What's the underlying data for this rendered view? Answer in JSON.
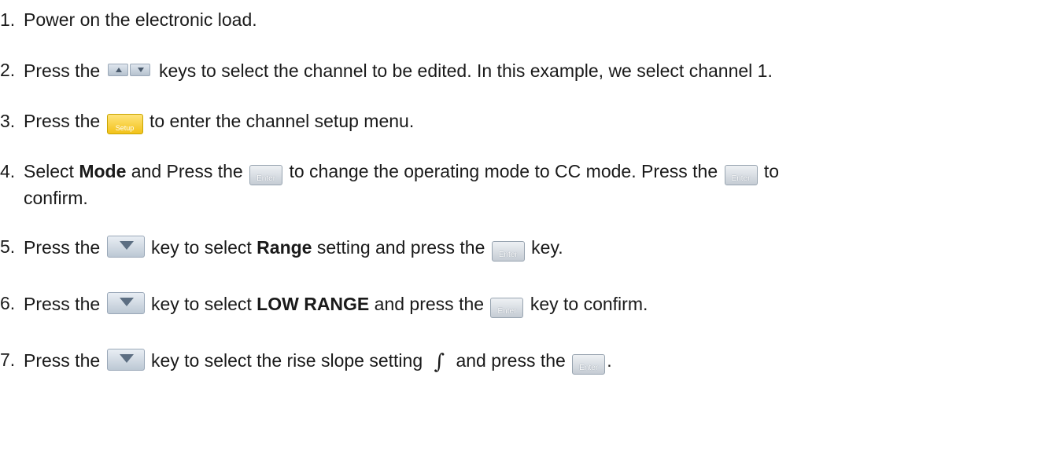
{
  "steps": [
    {
      "num": "1.",
      "text": "Power on the electronic load."
    },
    {
      "num": "2.",
      "pre": "Press the",
      "post": "keys to select the channel to be edited. In this example, we select channel 1."
    },
    {
      "num": "3.",
      "pre": "Press the",
      "post": "to enter the channel setup menu."
    },
    {
      "num": "4.",
      "pre": "Select",
      "bold": "Mode",
      "mid1": "and Press the",
      "mid2": "to change the operating mode to CC mode. Press the",
      "tail": "to",
      "cont": "confirm."
    },
    {
      "num": "5.",
      "pre": "Press the",
      "mid1": "key to select",
      "bold": "Range",
      "mid2": "setting and press the",
      "tail": "key."
    },
    {
      "num": "6.",
      "pre": "Press the",
      "mid1": "key to select",
      "bold": "LOW RANGE",
      "mid2": "and press the",
      "tail": "key to confirm."
    },
    {
      "num": "7.",
      "pre": "Press the",
      "mid1": "key to select the rise slope setting",
      "slope": "∫",
      "mid2": "and press the",
      "tail": "."
    }
  ],
  "keys": {
    "setup": "Setup",
    "enter": "Enter"
  },
  "colors": {
    "setup_key": "#f2c21a",
    "enter_key": "#c5ccd4"
  }
}
